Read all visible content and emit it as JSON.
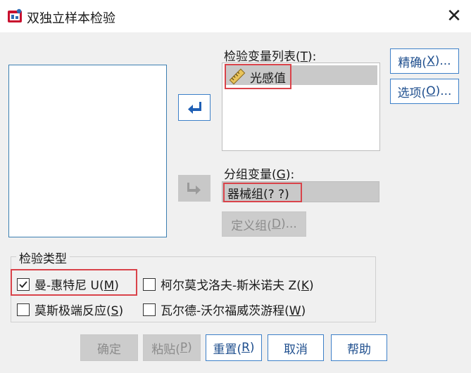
{
  "window": {
    "title": "双独立样本检验",
    "close_glyph": "✕"
  },
  "test_var_list": {
    "label": "检验变量列表(",
    "mnemonic": "T",
    "label_end": "):",
    "items": [
      {
        "name": "光感值",
        "icon": "ruler-icon"
      }
    ]
  },
  "grouping": {
    "label": "分组变量(",
    "mnemonic": "G",
    "label_end": "):",
    "value": "器械组(? ?)",
    "define_label": "定义组(",
    "define_mnemonic": "D",
    "define_end": ")..."
  },
  "side_buttons": {
    "exact_label": "精确(",
    "exact_mnemonic": "X",
    "exact_end": ")...",
    "options_label": "选项(",
    "options_mnemonic": "O",
    "options_end": ")..."
  },
  "test_type": {
    "title": "检验类型",
    "options": [
      {
        "label": "曼-惠特尼 U(",
        "mnemonic": "M",
        "end": ")",
        "checked": true
      },
      {
        "label": "柯尔莫戈洛夫-斯米诺夫 Z(",
        "mnemonic": "K",
        "end": ")",
        "checked": false
      },
      {
        "label": "莫斯极端反应(",
        "mnemonic": "S",
        "end": ")",
        "checked": false
      },
      {
        "label": "瓦尔德-沃尔福威茨游程(",
        "mnemonic": "W",
        "end": ")",
        "checked": false
      }
    ]
  },
  "footer": {
    "ok": "确定",
    "paste_label": "粘贴(",
    "paste_mnemonic": "P",
    "paste_end": ")",
    "reset_label": "重置(",
    "reset_mnemonic": "R",
    "reset_end": ")",
    "cancel": "取消",
    "help": "帮助"
  },
  "colors": {
    "accent_blue": "#3d80c8",
    "highlight_red": "#d9434a",
    "selection_gray": "#c9c9c9"
  }
}
